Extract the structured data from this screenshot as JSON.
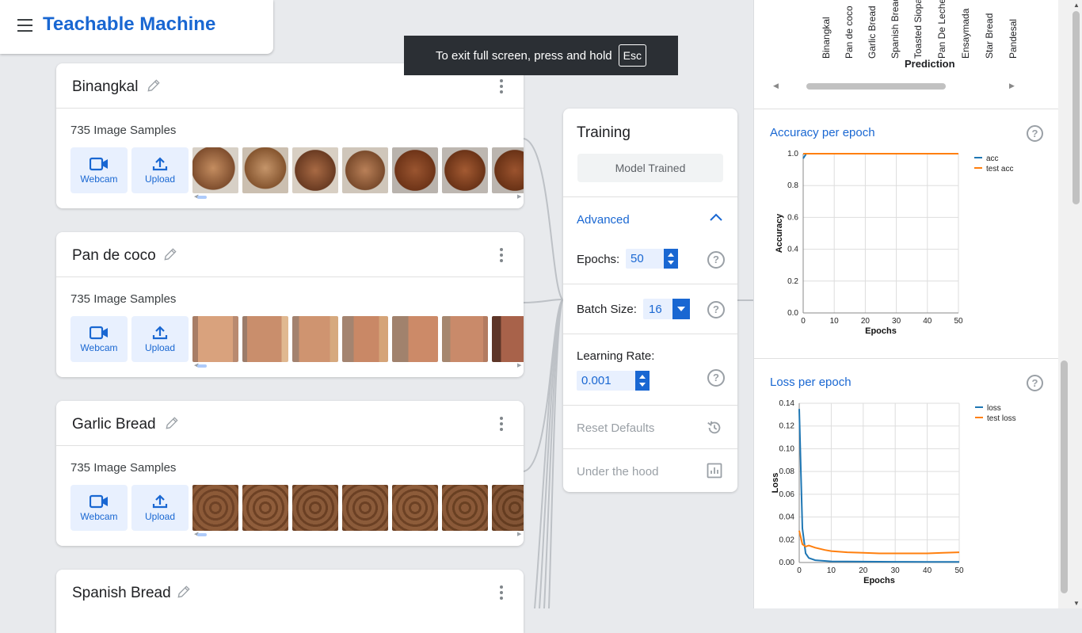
{
  "app": {
    "title": "Teachable Machine"
  },
  "fullscreen": {
    "message": "To exit full screen, press and hold",
    "key": "Esc"
  },
  "classes": [
    {
      "name": "Binangkal",
      "samples": "735 Image Samples",
      "webcam": "Webcam",
      "upload": "Upload",
      "colors": [
        "#a77650",
        "#9f7a57",
        "#8e5e3e",
        "#9d6f4f",
        "#8b4a29",
        "#874628",
        "#7d4222"
      ]
    },
    {
      "name": "Pan de coco",
      "samples": "735 Image Samples",
      "webcam": "Webcam",
      "upload": "Upload",
      "colors": [
        "#c78a6b",
        "#b37b60",
        "#bf8a6a",
        "#b8805e",
        "#c08d70",
        "#c08266",
        "#7a3a2a"
      ]
    },
    {
      "name": "Garlic Bread",
      "samples": "735 Image Samples",
      "webcam": "Webcam",
      "upload": "Upload",
      "colors": [
        "#8a5c3d",
        "#8d5f40",
        "#8a5b3b",
        "#875a3b",
        "#895a3a",
        "#875838",
        "#7d5234"
      ]
    },
    {
      "name": "Spanish Bread"
    }
  ],
  "training": {
    "title": "Training",
    "model_status": "Model Trained",
    "advanced": "Advanced",
    "epochs_label": "Epochs:",
    "epochs_value": "50",
    "batch_label": "Batch Size:",
    "batch_value": "16",
    "lr_label": "Learning Rate:",
    "lr_value": "0.001",
    "reset": "Reset Defaults",
    "under_hood": "Under the hood"
  },
  "confusion_matrix": {
    "class_labels": [
      "Binangkal",
      "Pan de coco",
      "Garlic Bread",
      "Spanish Bread",
      "Toasted Siopao",
      "Pan De Leche",
      "Ensaymada",
      "Star Bread",
      "Pandesal"
    ],
    "axis_label": "Prediction"
  },
  "chart_data": [
    {
      "type": "line",
      "title": "Accuracy per epoch",
      "xlabel": "Epochs",
      "ylabel": "Accuracy",
      "xlim": [
        0,
        50
      ],
      "ylim": [
        0,
        1.0
      ],
      "xticks": [
        "0",
        "10",
        "20",
        "30",
        "40",
        "50"
      ],
      "yticks": [
        "0.0",
        "0.2",
        "0.4",
        "0.6",
        "0.8",
        "1.0"
      ],
      "legend_position": "top-right",
      "series": [
        {
          "name": "acc",
          "color": "#1f77b4",
          "x": [
            0,
            1,
            2,
            5,
            10,
            20,
            30,
            40,
            50
          ],
          "y": [
            0.97,
            1.0,
            1.0,
            1.0,
            1.0,
            1.0,
            1.0,
            1.0,
            1.0
          ]
        },
        {
          "name": "test acc",
          "color": "#ff7f0e",
          "x": [
            0,
            1,
            2,
            5,
            10,
            20,
            30,
            40,
            50
          ],
          "y": [
            1.0,
            1.0,
            1.0,
            1.0,
            1.0,
            1.0,
            1.0,
            1.0,
            1.0
          ]
        }
      ]
    },
    {
      "type": "line",
      "title": "Loss per epoch",
      "xlabel": "Epochs",
      "ylabel": "Loss",
      "xlim": [
        0,
        50
      ],
      "ylim": [
        0,
        0.14
      ],
      "xticks": [
        "0",
        "10",
        "20",
        "30",
        "40",
        "50"
      ],
      "yticks": [
        "0.00",
        "0.02",
        "0.04",
        "0.06",
        "0.08",
        "0.10",
        "0.12",
        "0.14"
      ],
      "legend_position": "top-right",
      "series": [
        {
          "name": "loss",
          "color": "#1f77b4",
          "x": [
            0,
            1,
            2,
            3,
            5,
            10,
            20,
            30,
            40,
            50
          ],
          "y": [
            0.135,
            0.03,
            0.008,
            0.004,
            0.002,
            0.001,
            0.0008,
            0.0006,
            0.0005,
            0.0005
          ]
        },
        {
          "name": "test loss",
          "color": "#ff7f0e",
          "x": [
            0,
            1,
            2,
            3,
            5,
            8,
            10,
            15,
            20,
            25,
            30,
            35,
            40,
            45,
            50
          ],
          "y": [
            0.028,
            0.016,
            0.014,
            0.015,
            0.013,
            0.011,
            0.01,
            0.009,
            0.0085,
            0.008,
            0.008,
            0.008,
            0.008,
            0.0085,
            0.009
          ]
        }
      ]
    }
  ]
}
